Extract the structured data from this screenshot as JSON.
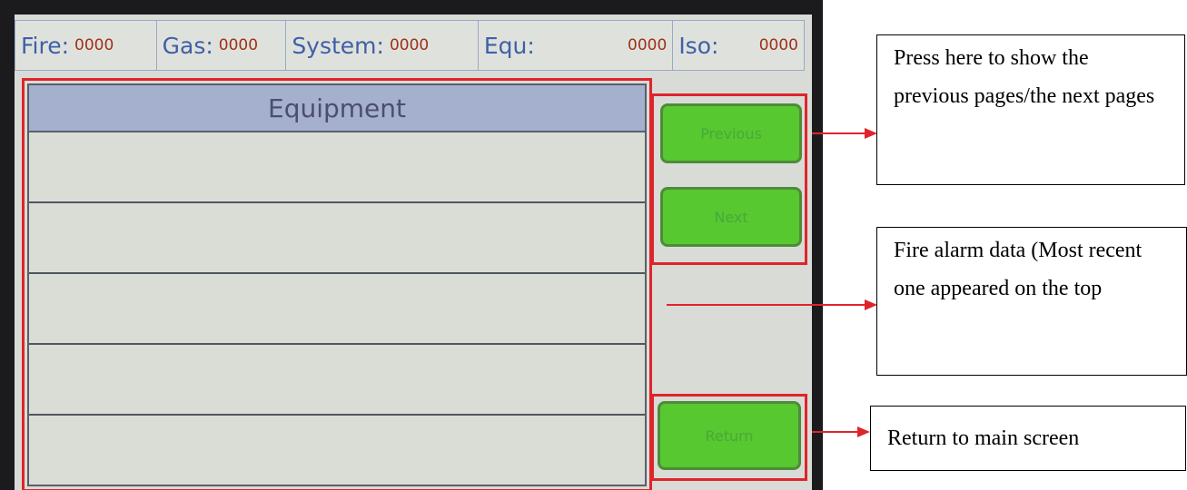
{
  "status_bar": {
    "fire": {
      "label": "Fire:",
      "value": "0000"
    },
    "gas": {
      "label": "Gas:",
      "value": "0000"
    },
    "system": {
      "label": "System:",
      "value": "0000"
    },
    "equ": {
      "label": "Equ:",
      "value": "0000"
    },
    "iso": {
      "label": "Iso:",
      "value": "0000"
    }
  },
  "table": {
    "header": "Equipment",
    "rows": [
      "",
      "",
      "",
      "",
      ""
    ]
  },
  "buttons": {
    "previous": "Previous",
    "next": "Next",
    "return": "Return"
  },
  "annotations": {
    "pages": "Press here to show the previous pages/the next pages",
    "fire_data": "Fire alarm data (Most recent one appeared on the top",
    "return": "Return to main screen"
  },
  "colors": {
    "highlight_red": "#e0242b",
    "button_green": "#57c830",
    "header_blue": "#a5b0ce",
    "label_blue": "#3f5fa8",
    "value_red": "#a03018"
  }
}
